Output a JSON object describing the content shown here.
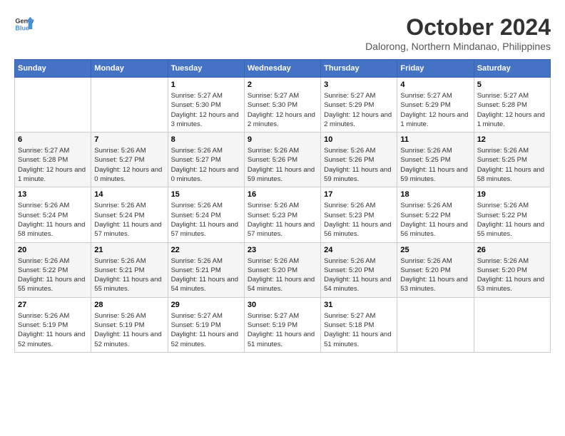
{
  "header": {
    "logo_line1": "General",
    "logo_line2": "Blue",
    "month_year": "October 2024",
    "location": "Dalorong, Northern Mindanao, Philippines"
  },
  "weekdays": [
    "Sunday",
    "Monday",
    "Tuesday",
    "Wednesday",
    "Thursday",
    "Friday",
    "Saturday"
  ],
  "weeks": [
    [
      {
        "day": "",
        "info": ""
      },
      {
        "day": "",
        "info": ""
      },
      {
        "day": "1",
        "info": "Sunrise: 5:27 AM\nSunset: 5:30 PM\nDaylight: 12 hours and 3 minutes."
      },
      {
        "day": "2",
        "info": "Sunrise: 5:27 AM\nSunset: 5:30 PM\nDaylight: 12 hours and 2 minutes."
      },
      {
        "day": "3",
        "info": "Sunrise: 5:27 AM\nSunset: 5:29 PM\nDaylight: 12 hours and 2 minutes."
      },
      {
        "day": "4",
        "info": "Sunrise: 5:27 AM\nSunset: 5:29 PM\nDaylight: 12 hours and 1 minute."
      },
      {
        "day": "5",
        "info": "Sunrise: 5:27 AM\nSunset: 5:28 PM\nDaylight: 12 hours and 1 minute."
      }
    ],
    [
      {
        "day": "6",
        "info": "Sunrise: 5:27 AM\nSunset: 5:28 PM\nDaylight: 12 hours and 1 minute."
      },
      {
        "day": "7",
        "info": "Sunrise: 5:26 AM\nSunset: 5:27 PM\nDaylight: 12 hours and 0 minutes."
      },
      {
        "day": "8",
        "info": "Sunrise: 5:26 AM\nSunset: 5:27 PM\nDaylight: 12 hours and 0 minutes."
      },
      {
        "day": "9",
        "info": "Sunrise: 5:26 AM\nSunset: 5:26 PM\nDaylight: 11 hours and 59 minutes."
      },
      {
        "day": "10",
        "info": "Sunrise: 5:26 AM\nSunset: 5:26 PM\nDaylight: 11 hours and 59 minutes."
      },
      {
        "day": "11",
        "info": "Sunrise: 5:26 AM\nSunset: 5:25 PM\nDaylight: 11 hours and 59 minutes."
      },
      {
        "day": "12",
        "info": "Sunrise: 5:26 AM\nSunset: 5:25 PM\nDaylight: 11 hours and 58 minutes."
      }
    ],
    [
      {
        "day": "13",
        "info": "Sunrise: 5:26 AM\nSunset: 5:24 PM\nDaylight: 11 hours and 58 minutes."
      },
      {
        "day": "14",
        "info": "Sunrise: 5:26 AM\nSunset: 5:24 PM\nDaylight: 11 hours and 57 minutes."
      },
      {
        "day": "15",
        "info": "Sunrise: 5:26 AM\nSunset: 5:24 PM\nDaylight: 11 hours and 57 minutes."
      },
      {
        "day": "16",
        "info": "Sunrise: 5:26 AM\nSunset: 5:23 PM\nDaylight: 11 hours and 57 minutes."
      },
      {
        "day": "17",
        "info": "Sunrise: 5:26 AM\nSunset: 5:23 PM\nDaylight: 11 hours and 56 minutes."
      },
      {
        "day": "18",
        "info": "Sunrise: 5:26 AM\nSunset: 5:22 PM\nDaylight: 11 hours and 56 minutes."
      },
      {
        "day": "19",
        "info": "Sunrise: 5:26 AM\nSunset: 5:22 PM\nDaylight: 11 hours and 55 minutes."
      }
    ],
    [
      {
        "day": "20",
        "info": "Sunrise: 5:26 AM\nSunset: 5:22 PM\nDaylight: 11 hours and 55 minutes."
      },
      {
        "day": "21",
        "info": "Sunrise: 5:26 AM\nSunset: 5:21 PM\nDaylight: 11 hours and 55 minutes."
      },
      {
        "day": "22",
        "info": "Sunrise: 5:26 AM\nSunset: 5:21 PM\nDaylight: 11 hours and 54 minutes."
      },
      {
        "day": "23",
        "info": "Sunrise: 5:26 AM\nSunset: 5:20 PM\nDaylight: 11 hours and 54 minutes."
      },
      {
        "day": "24",
        "info": "Sunrise: 5:26 AM\nSunset: 5:20 PM\nDaylight: 11 hours and 54 minutes."
      },
      {
        "day": "25",
        "info": "Sunrise: 5:26 AM\nSunset: 5:20 PM\nDaylight: 11 hours and 53 minutes."
      },
      {
        "day": "26",
        "info": "Sunrise: 5:26 AM\nSunset: 5:20 PM\nDaylight: 11 hours and 53 minutes."
      }
    ],
    [
      {
        "day": "27",
        "info": "Sunrise: 5:26 AM\nSunset: 5:19 PM\nDaylight: 11 hours and 52 minutes."
      },
      {
        "day": "28",
        "info": "Sunrise: 5:26 AM\nSunset: 5:19 PM\nDaylight: 11 hours and 52 minutes."
      },
      {
        "day": "29",
        "info": "Sunrise: 5:27 AM\nSunset: 5:19 PM\nDaylight: 11 hours and 52 minutes."
      },
      {
        "day": "30",
        "info": "Sunrise: 5:27 AM\nSunset: 5:19 PM\nDaylight: 11 hours and 51 minutes."
      },
      {
        "day": "31",
        "info": "Sunrise: 5:27 AM\nSunset: 5:18 PM\nDaylight: 11 hours and 51 minutes."
      },
      {
        "day": "",
        "info": ""
      },
      {
        "day": "",
        "info": ""
      }
    ]
  ]
}
